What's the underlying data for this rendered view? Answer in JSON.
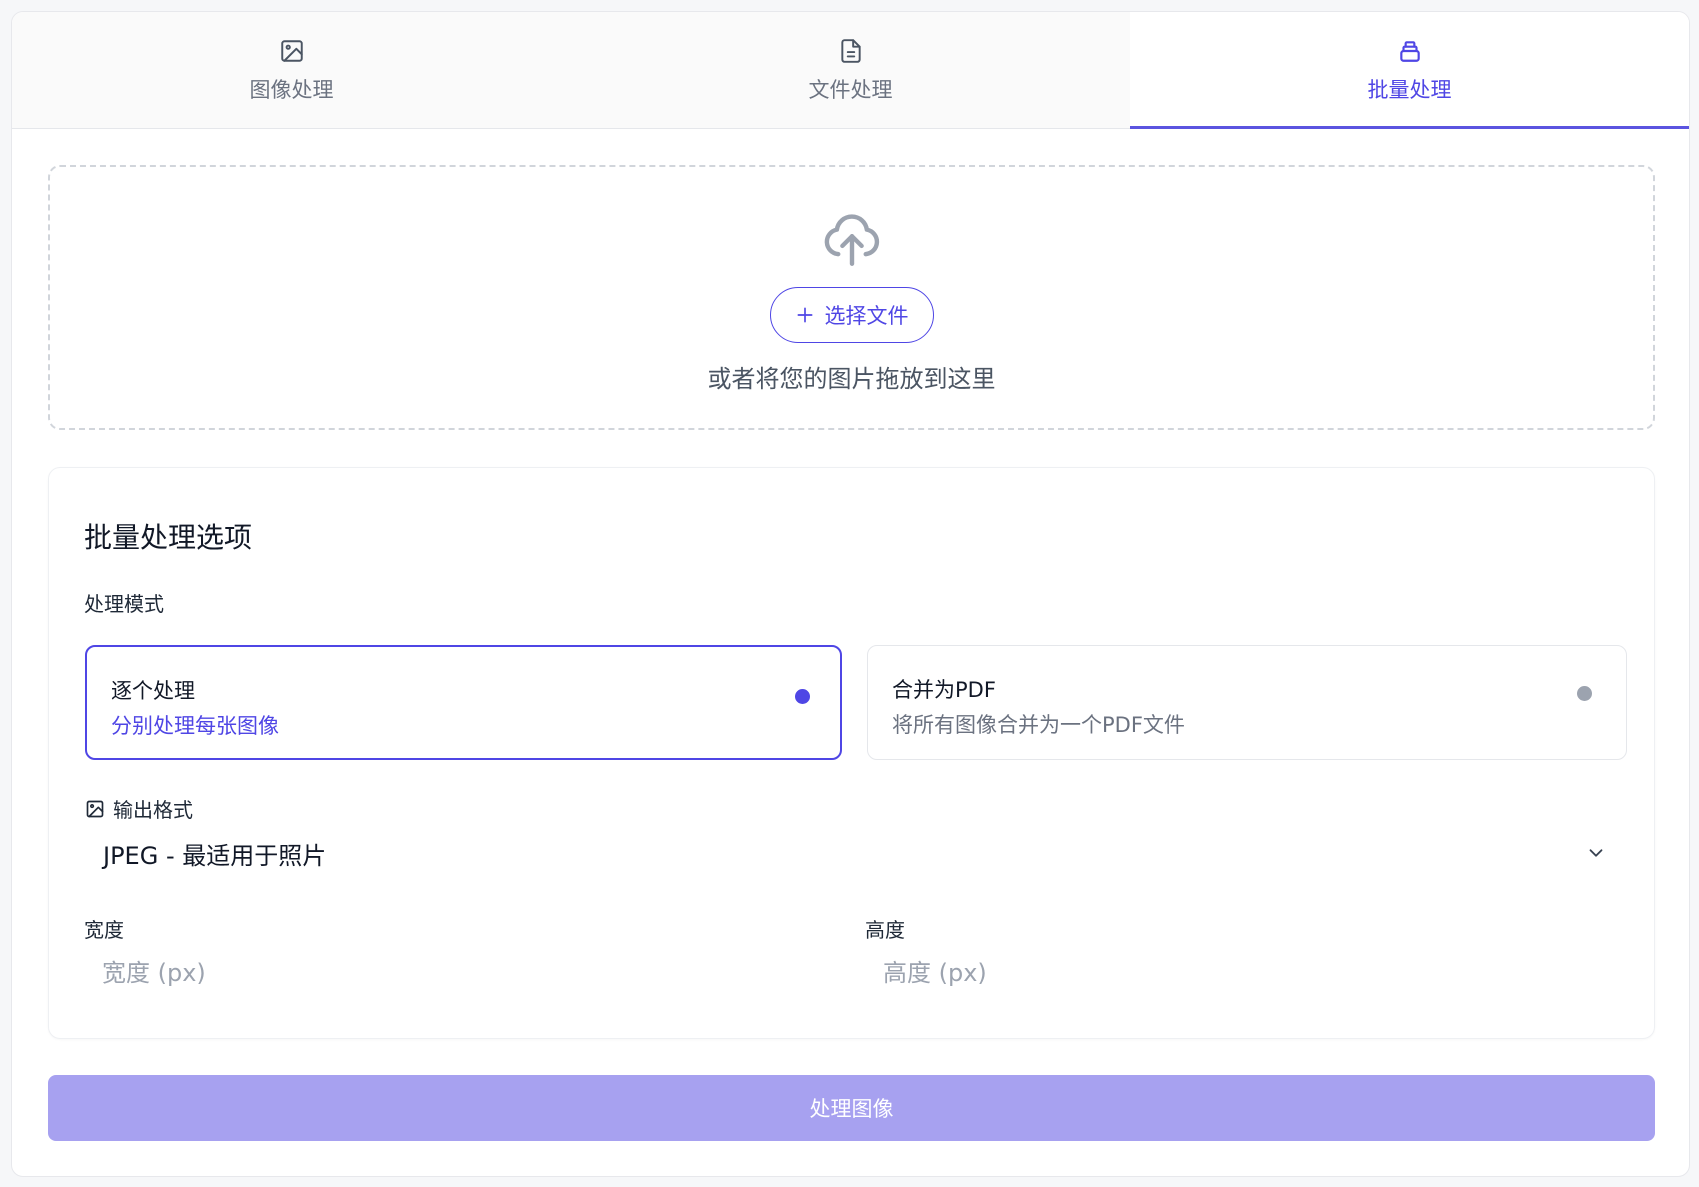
{
  "tabs": [
    {
      "label": "图像处理",
      "icon": "image-icon",
      "active": false
    },
    {
      "label": "文件处理",
      "icon": "file-icon",
      "active": false
    },
    {
      "label": "批量处理",
      "icon": "layers-icon",
      "active": true
    }
  ],
  "upload": {
    "icon": "cloud-upload-icon",
    "button_label": "选择文件",
    "hint": "或者将您的图片拖放到这里"
  },
  "options": {
    "title": "批量处理选项",
    "mode_label": "处理模式",
    "modes": [
      {
        "title": "逐个处理",
        "description": "分别处理每张图像",
        "selected": true
      },
      {
        "title": "合并为PDF",
        "description": "将所有图像合并为一个PDF文件",
        "selected": false
      }
    ],
    "format_label": "输出格式",
    "format_value": "JPEG - 最适用于照片",
    "width_label": "宽度",
    "width_placeholder": "宽度 (px)",
    "height_label": "高度",
    "height_placeholder": "高度 (px)"
  },
  "submit_label": "处理图像",
  "colors": {
    "accent": "#4f46e5",
    "submit_disabled": "#a7a1f0"
  }
}
